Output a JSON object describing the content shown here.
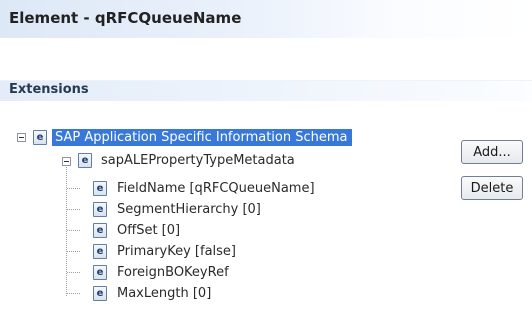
{
  "header": {
    "title": "Element - qRFCQueueName"
  },
  "section": {
    "title": "Extensions"
  },
  "tree": {
    "root": {
      "label": "SAP Application Specific Information Schema",
      "icon": "element-e-icon"
    },
    "child": {
      "label": "sapALEPropertyTypeMetadata",
      "icon": "element-e-icon"
    },
    "leaves": [
      {
        "label": "FieldName [qRFCQueueName]"
      },
      {
        "label": "SegmentHierarchy [0]"
      },
      {
        "label": "OffSet [0]"
      },
      {
        "label": "PrimaryKey [false]"
      },
      {
        "label": "ForeignBOKeyRef"
      },
      {
        "label": "MaxLength [0]"
      }
    ]
  },
  "buttons": {
    "add": "Add...",
    "delete": "Delete"
  },
  "colors": {
    "selection": "#3878d8",
    "header_gradient": "#dde8f7"
  }
}
